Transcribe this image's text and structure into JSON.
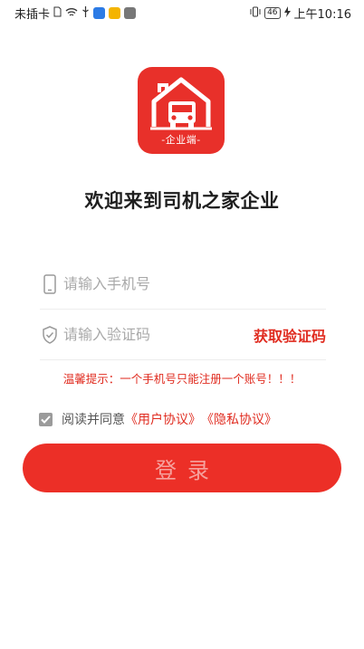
{
  "status_bar": {
    "carrier": "未插卡",
    "battery": "46",
    "time": "上午10:16"
  },
  "logo": {
    "caption": "-企业端-",
    "color": "#e8302a"
  },
  "welcome_title": "欢迎来到司机之家企业",
  "phone_field": {
    "placeholder": "请输入手机号",
    "value": "",
    "icon": "phone-icon"
  },
  "code_field": {
    "placeholder": "请输入验证码",
    "value": "",
    "icon": "shield-check-icon",
    "get_code_label": "获取验证码"
  },
  "tip": "温馨提示：一个手机号只能注册一个账号！！！",
  "agreement": {
    "checked": true,
    "prefix": "阅读并同意",
    "user_agreement": "《用户协议》",
    "privacy_policy": "《隐私协议》"
  },
  "login_button": {
    "label": "登录"
  },
  "colors": {
    "accent": "#ec2f27",
    "link": "#e02c20",
    "placeholder": "#a9a9a9"
  }
}
